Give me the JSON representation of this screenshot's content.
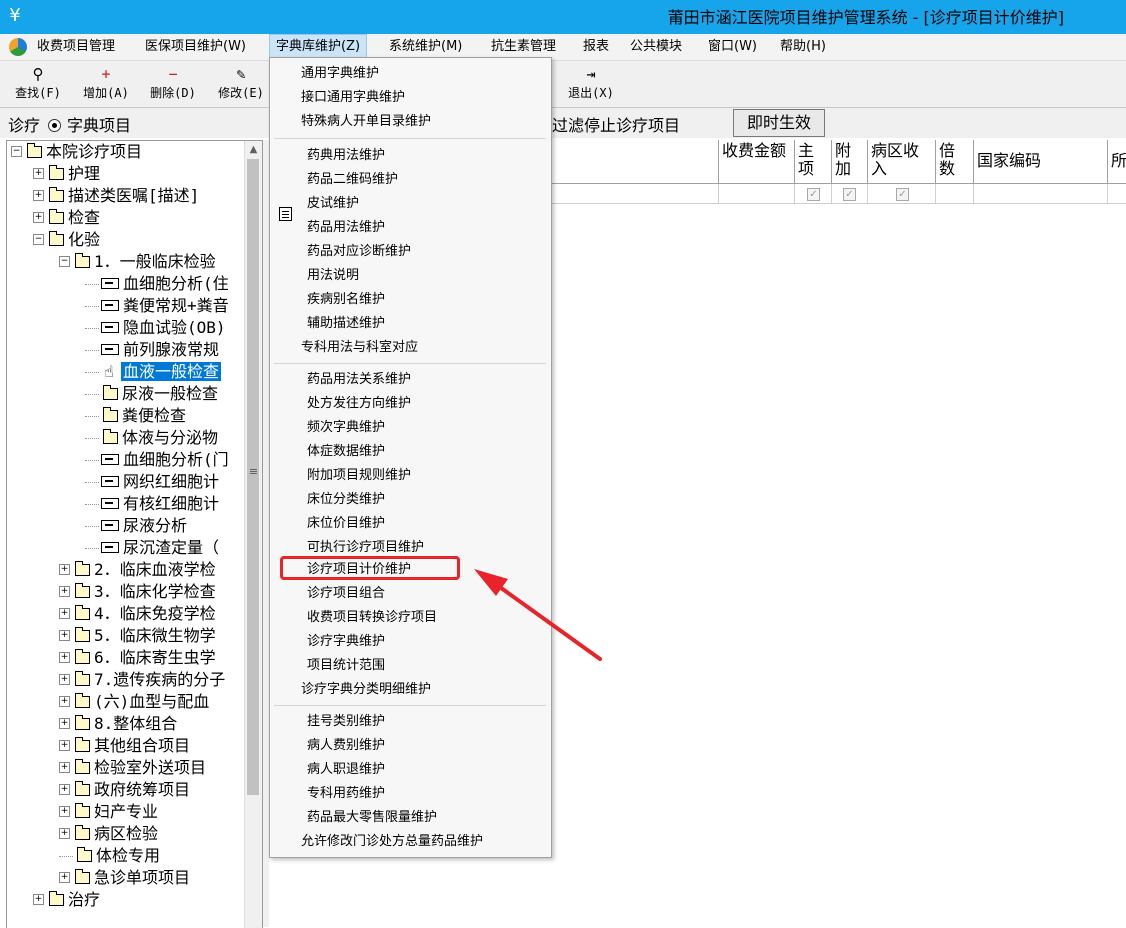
{
  "window": {
    "title": "莆田市涵江医院项目维护管理系统 - [诊疗项目计价维护]",
    "app_icon": "yuan-currency-icon"
  },
  "menubar": {
    "items": [
      "收费项目管理",
      "医保项目维护(W)",
      "字典库维护(Z)",
      "系统维护(M)",
      "抗生素管理",
      "报表",
      "公共模块",
      "窗口(W)",
      "帮助(H)"
    ],
    "active": "字典库维护(Z)"
  },
  "toolbar": {
    "find": "查找(F)",
    "add": "增加(A)",
    "delete": "删除(D)",
    "modify": "修改(E)",
    "exit": "退出(X)"
  },
  "filter": {
    "scope_label": "诊疗",
    "radio_label": "字典项目",
    "filter_label": "过滤停止诊疗项目",
    "apply_button": "即时生效"
  },
  "tree": {
    "root": "本院诊疗项目",
    "nodes": [
      "护理",
      "描述类医嘱[描述]",
      "检查",
      "化验",
      "1．一般临床检验",
      "血细胞分析(住",
      "粪便常规+粪音",
      "隐血试验(OB)",
      "前列腺液常规",
      "血液一般检查",
      "尿液一般检查",
      "粪便检查",
      "体液与分泌物",
      "血细胞分析(门",
      "网织红细胞计",
      "有核红细胞计",
      "尿液分析",
      "尿沉渣定量（",
      "2．临床血液学检",
      "3．临床化学检查",
      "4．临床免疫学检",
      "5．临床微生物学",
      "6．临床寄生虫学",
      "7.遗传疾病的分子",
      "(六)血型与配血",
      "8.整体组合",
      "其他组合项目",
      "检验室外送项目",
      "政府统筹项目",
      "妇产专业",
      "病区检验",
      "体检专用",
      "急诊单项项目",
      "治疗"
    ],
    "selected": "血液一般检查"
  },
  "grid": {
    "headers": [
      "收费金额",
      "主项",
      "附加",
      "病区收入",
      "倍数",
      "国家编码",
      "所"
    ]
  },
  "dropdown": {
    "group1": [
      "通用字典维护",
      "接口通用字典维护",
      "特殊病人开单目录维护"
    ],
    "group2": [
      "药典用法维护",
      "药品二维码维护",
      "皮试维护",
      "药品用法维护",
      "药品对应诊断维护",
      "用法说明",
      "疾病别名维护",
      "辅助描述维护",
      "专科用法与科室对应"
    ],
    "group3": [
      "药品用法关系维护",
      "处方发往方向维护",
      "频次字典维护",
      "体症数据维护",
      "附加项目规则维护",
      "床位分类维护",
      "床位价目维护",
      "可执行诊疗项目维护",
      "诊疗项目计价维护",
      "诊疗项目组合",
      "收费项目转换诊疗项目",
      "诊疗字典维护",
      "项目统计范围",
      "诊疗字典分类明细维护"
    ],
    "group4": [
      "挂号类别维护",
      "病人费别维护",
      "病人职退维护",
      "专科用药维护",
      "药品最大零售限量维护",
      "允许修改门诊处方总量药品维护"
    ],
    "highlighted": "诊疗项目计价维护"
  },
  "colors": {
    "titlebar": "#16a5eb",
    "selection": "#0078d7",
    "annotation": "#e8232a"
  }
}
